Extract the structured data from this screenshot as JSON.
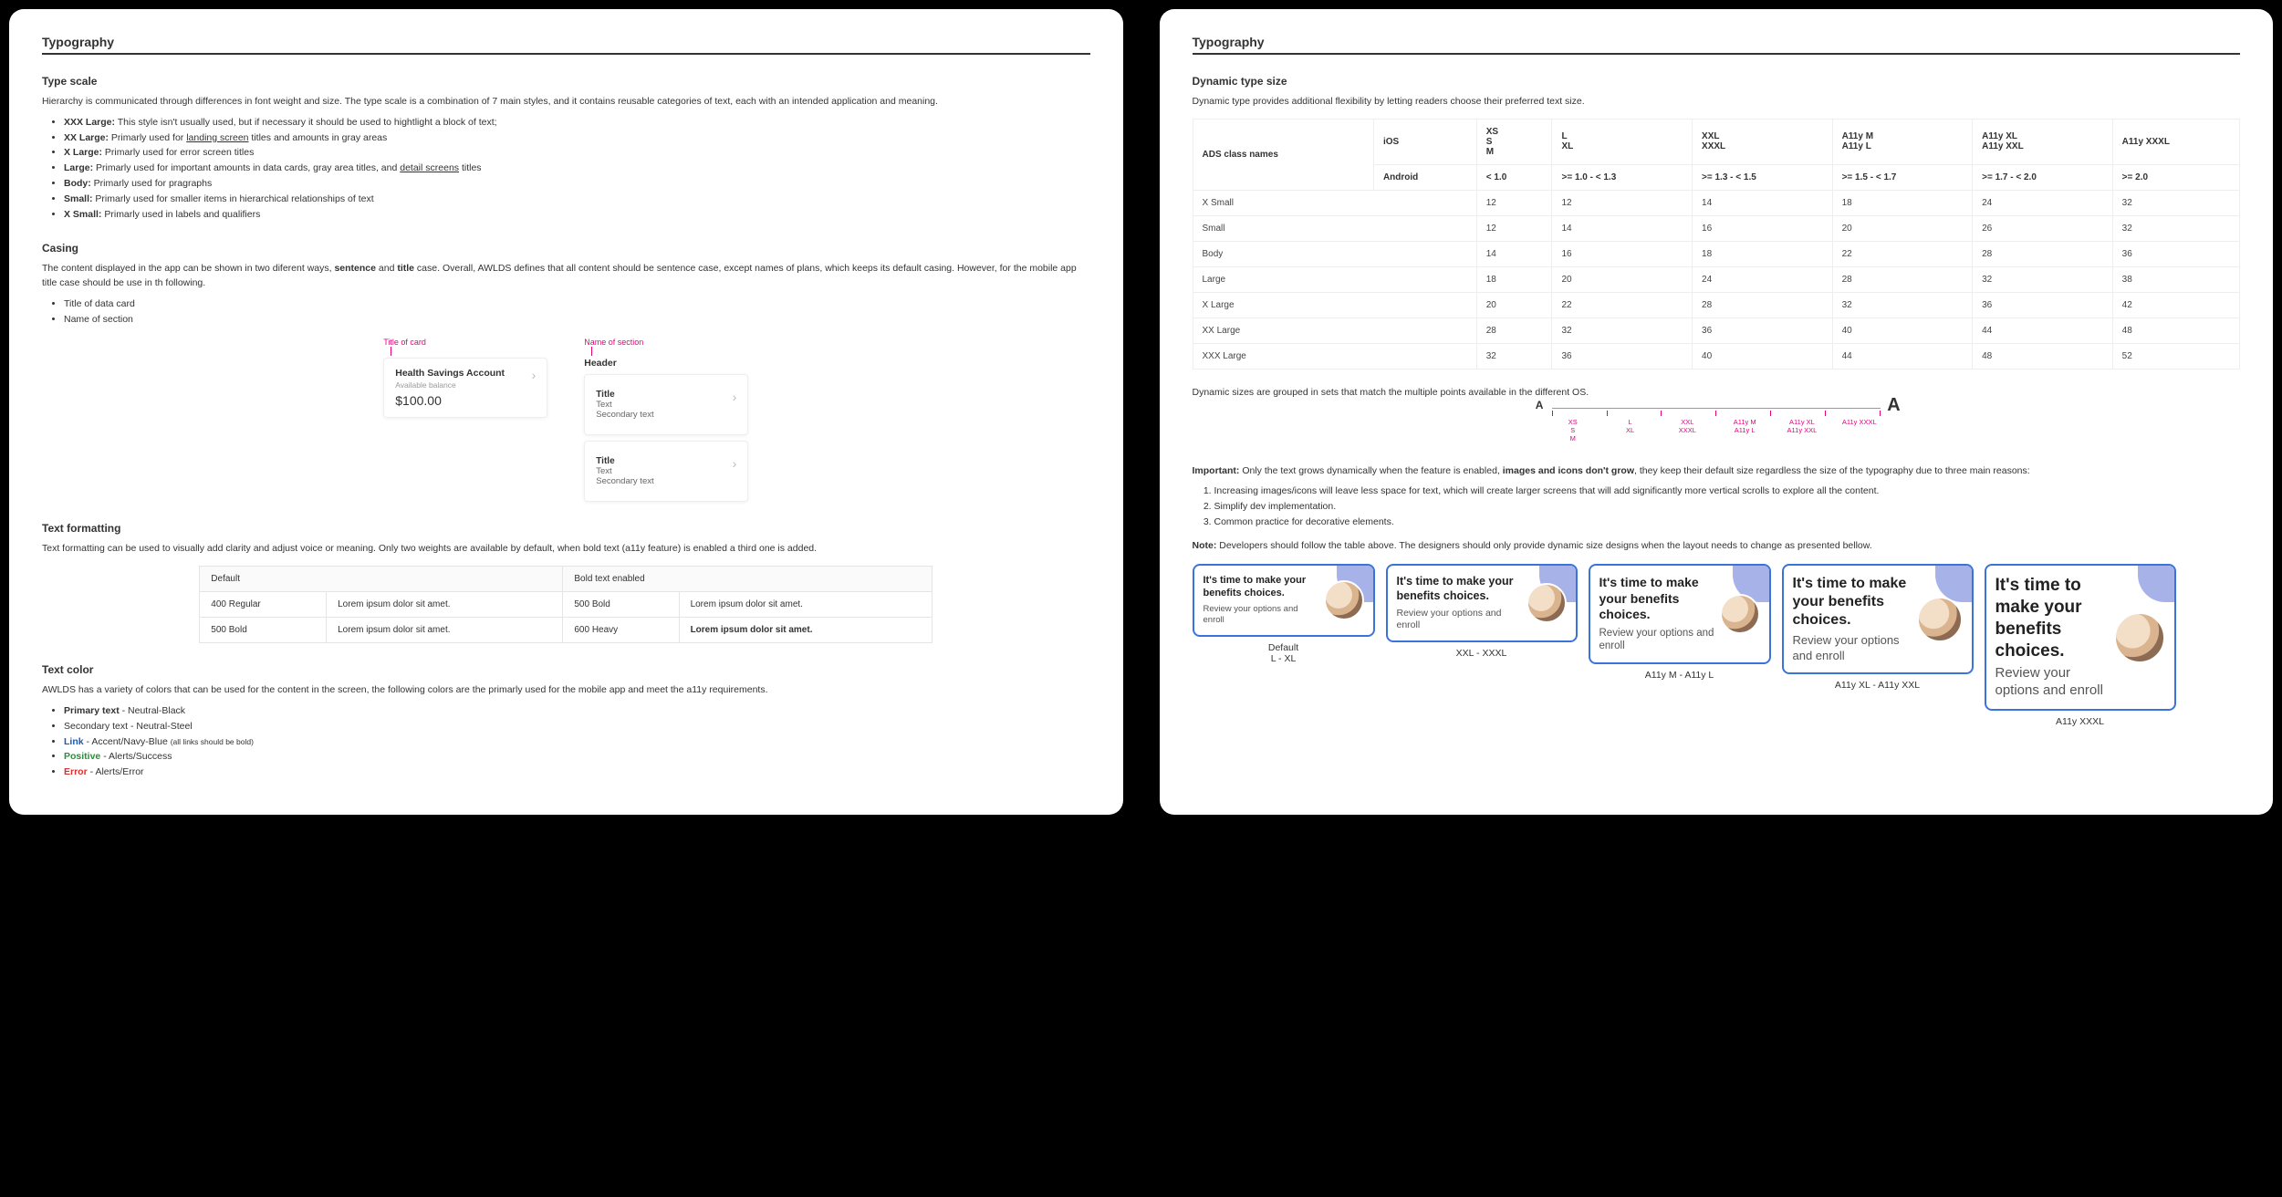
{
  "left": {
    "title": "Typography",
    "typescale": {
      "heading": "Type scale",
      "intro": "Hierarchy is communicated through differences in font weight and size. The type scale is a combination of 7 main styles, and it contains reusable categories of text, each with an intended application and meaning.",
      "items": [
        {
          "label": "XXX Large:",
          "text": " This style isn't usually used, but if necessary it should be used to hightlight a block of text;"
        },
        {
          "label": "XX Large:",
          "text_pre": " Primarly used for ",
          "u": "landing screen",
          "text_post": " titles and amounts in gray areas"
        },
        {
          "label": "X Large:",
          "text": " Primarly used for error screen titles"
        },
        {
          "label": "Large:",
          "text_pre": " Primarly used for important amounts in data cards, gray area titles, and ",
          "u": "detail screens",
          "text_post": " titles"
        },
        {
          "label": "Body:",
          "text": " Primarly used for pragraphs"
        },
        {
          "label": "Small:",
          "text": " Primarly used for smaller items in hierarchical relationships of text"
        },
        {
          "label": "X Small:",
          "text": " Primarly used in labels and qualifiers"
        }
      ]
    },
    "casing": {
      "heading": "Casing",
      "intro_pre": "The content displayed in the app can be shown in two diferent ways, ",
      "bold1": "sentence",
      "mid": " and ",
      "bold2": "title",
      "intro_post": " case. Overall, AWLDS defines that all content should be sentence case, except names of plans, which keeps its default casing. However,  for the mobile app title case should be use in th following.",
      "list": [
        "Title of data card",
        "Name of section"
      ],
      "anno1": "Title of card",
      "anno2": "Name of section",
      "card": {
        "title": "Health Savings Account",
        "sub": "Available balance",
        "amount": "$100.00"
      },
      "header_label": "Header",
      "row_title": "Title",
      "row_text": "Text",
      "row_secondary": "Secondary text"
    },
    "formatting": {
      "heading": "Text formatting",
      "intro": "Text formatting can be used to visually add clarity and adjust voice or meaning. Only two weights are available by default, when bold text (a11y feature) is enabled a third one is added.",
      "col1": "Default",
      "col2": "Bold text enabled",
      "rows": [
        [
          "400 Regular",
          "Lorem ipsum dolor sit amet.",
          "500 Bold",
          "Lorem ipsum dolor sit amet."
        ],
        [
          "500 Bold",
          "Lorem ipsum dolor sit amet.",
          "600 Heavy",
          "Lorem ipsum dolor sit amet."
        ]
      ]
    },
    "colors": {
      "heading": "Text color",
      "intro": "AWLDS has a variety of colors that can be used for the content in the screen, the following colors are the primarly used for the mobile app and meet the a11y requirements.",
      "items": [
        {
          "label": "Primary text",
          "text": " - Neutral-Black"
        },
        {
          "label": "Secondary text",
          "text": " - Neutral-Steel"
        },
        {
          "label": "Link",
          "text": " - Accent/Navy-Blue ",
          "note": "(all links should be bold)"
        },
        {
          "label": "Positive",
          "text": " - Alerts/Success"
        },
        {
          "label": "Error",
          "text": " - Alerts/Error"
        }
      ]
    }
  },
  "right": {
    "title": "Typography",
    "dyn": {
      "heading": "Dynamic type size",
      "intro": "Dynamic type provides additional flexibility by letting readers choose their preferred text size.",
      "corner": "ADS class names",
      "os_rows": [
        "iOS",
        "Android"
      ],
      "cols": [
        {
          "a": "XS",
          "b": "S",
          "c": "M",
          "and": "< 1.0"
        },
        {
          "a": "L",
          "b": "XL",
          "and": ">= 1.0 - < 1.3"
        },
        {
          "a": "XXL",
          "b": "XXXL",
          "and": ">= 1.3 - < 1.5"
        },
        {
          "a": "A11y M",
          "b": "A11y L",
          "and": ">= 1.5 - < 1.7"
        },
        {
          "a": "A11y XL",
          "b": "A11y XXL",
          "and": ">= 1.7 - < 2.0"
        },
        {
          "a": "A11y XXXL",
          "and": ">= 2.0"
        }
      ],
      "rows": [
        {
          "name": "X Small",
          "v": [
            12,
            12,
            14,
            18,
            24,
            32
          ]
        },
        {
          "name": "Small",
          "v": [
            12,
            14,
            16,
            20,
            26,
            32
          ]
        },
        {
          "name": "Body",
          "v": [
            14,
            16,
            18,
            22,
            28,
            36
          ]
        },
        {
          "name": "Large",
          "v": [
            18,
            20,
            24,
            28,
            32,
            38
          ]
        },
        {
          "name": "X Large",
          "v": [
            20,
            22,
            28,
            32,
            36,
            42
          ]
        },
        {
          "name": "XX Large",
          "v": [
            28,
            32,
            36,
            40,
            44,
            48
          ]
        },
        {
          "name": "XXX Large",
          "v": [
            32,
            36,
            40,
            44,
            48,
            52
          ]
        }
      ],
      "grouped": "Dynamic sizes are grouped in sets that match the multiple points available in the different OS.",
      "tick_labels": [
        "XS\nS\nM",
        "L\nXL",
        "XXL\nXXXL",
        "A11y M\nA11y L",
        "A11y XL\nA11y XXL",
        "A11y XXXL"
      ],
      "important_lead": "Important:",
      "important_pre": " Only the text grows dynamically when the feature is enabled, ",
      "important_bold": "images and icons don't grow",
      "important_post": ", they keep their default size regardless the size of the typography due to three main reasons:",
      "reasons": [
        "Increasing images/icons will leave less space for text, which will create larger screens that will add significantly more vertical scrolls to explore all the content.",
        "Simplify dev implementation.",
        "Common practice for decorative elements."
      ],
      "note_lead": "Note:",
      "note": " Developers should follow the table above. The designers should only provide dynamic size designs when the layout needs to change as presented bellow.",
      "preview": {
        "title": "It's time to make your benefits choices.",
        "sub": "Review your options and enroll",
        "labels": [
          "Default\nL - XL",
          "XXL - XXXL",
          "A11y M - A11y L",
          "A11y XL - A11y XXL",
          "A11y XXXL"
        ]
      }
    }
  }
}
